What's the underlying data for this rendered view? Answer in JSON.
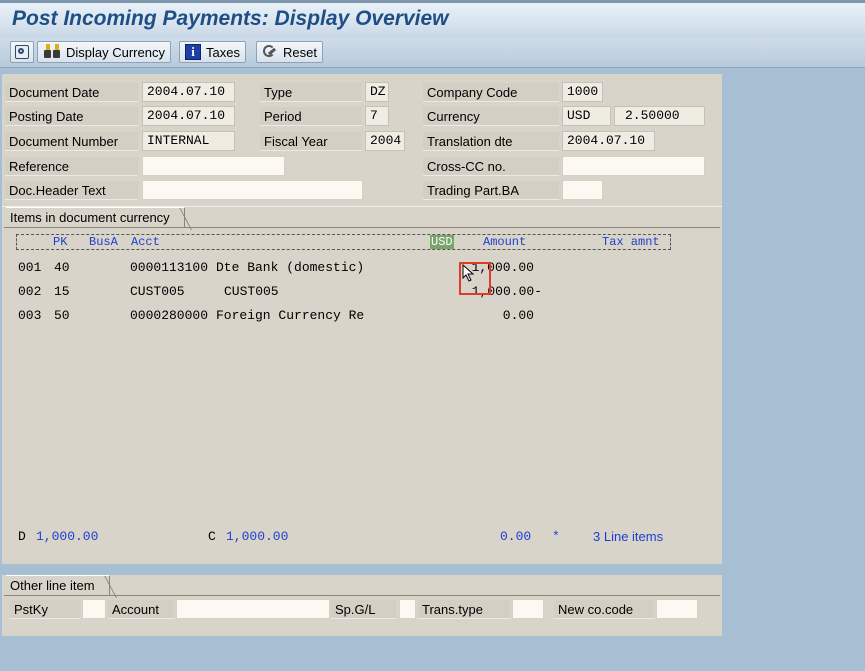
{
  "title": "Post Incoming Payments: Display Overview",
  "toolbar": {
    "display_currency": "Display Currency",
    "taxes": "Taxes",
    "reset": "Reset"
  },
  "header": {
    "document_date_label": "Document Date",
    "document_date": "2004.07.10",
    "posting_date_label": "Posting Date",
    "posting_date": "2004.07.10",
    "document_number_label": "Document Number",
    "document_number": "INTERNAL",
    "reference_label": "Reference",
    "reference": "",
    "doc_header_text_label": "Doc.Header Text",
    "doc_header_text": "",
    "type_label": "Type",
    "type": "DZ",
    "period_label": "Period",
    "period": "7",
    "fiscal_year_label": "Fiscal Year",
    "fiscal_year": "2004",
    "company_code_label": "Company Code",
    "company_code": "1000",
    "currency_label": "Currency",
    "currency": "USD",
    "exchange_rate": "2.50000",
    "translation_date_label": "Translation dte",
    "translation_date": "2004.07.10",
    "cross_cc_label": "Cross-CC no.",
    "cross_cc": "",
    "trading_part_label": "Trading Part.BA",
    "trading_part": ""
  },
  "items": {
    "tab_title": "Items in document currency",
    "columns": {
      "pk": "PK",
      "busa": "BusA",
      "acct": "Acct",
      "currency": "USD",
      "amount": "Amount",
      "tax": "Tax amnt"
    },
    "rows": [
      {
        "item": "001",
        "pk": "40",
        "acct": "0000113100",
        "desc": "Dte Bank (domestic)",
        "amount": "1,000.00"
      },
      {
        "item": "002",
        "pk": "15",
        "acct": "CUST005",
        "desc": "CUST005",
        "amount": "1,000.00-"
      },
      {
        "item": "003",
        "pk": "50",
        "acct": "0000280000",
        "desc": "Foreign Currency Re",
        "amount": "0.00"
      }
    ],
    "totals": {
      "debit_label": "D",
      "debit": "1,000.00",
      "credit_label": "C",
      "credit": "1,000.00",
      "balance": "0.00",
      "marker": "*",
      "line_items": "3 Line items"
    }
  },
  "other": {
    "tab_title": "Other line item",
    "pstky_label": "PstKy",
    "account_label": "Account",
    "spgl_label": "Sp.G/L",
    "trans_type_label": "Trans.type",
    "new_cocode_label": "New co.code"
  }
}
